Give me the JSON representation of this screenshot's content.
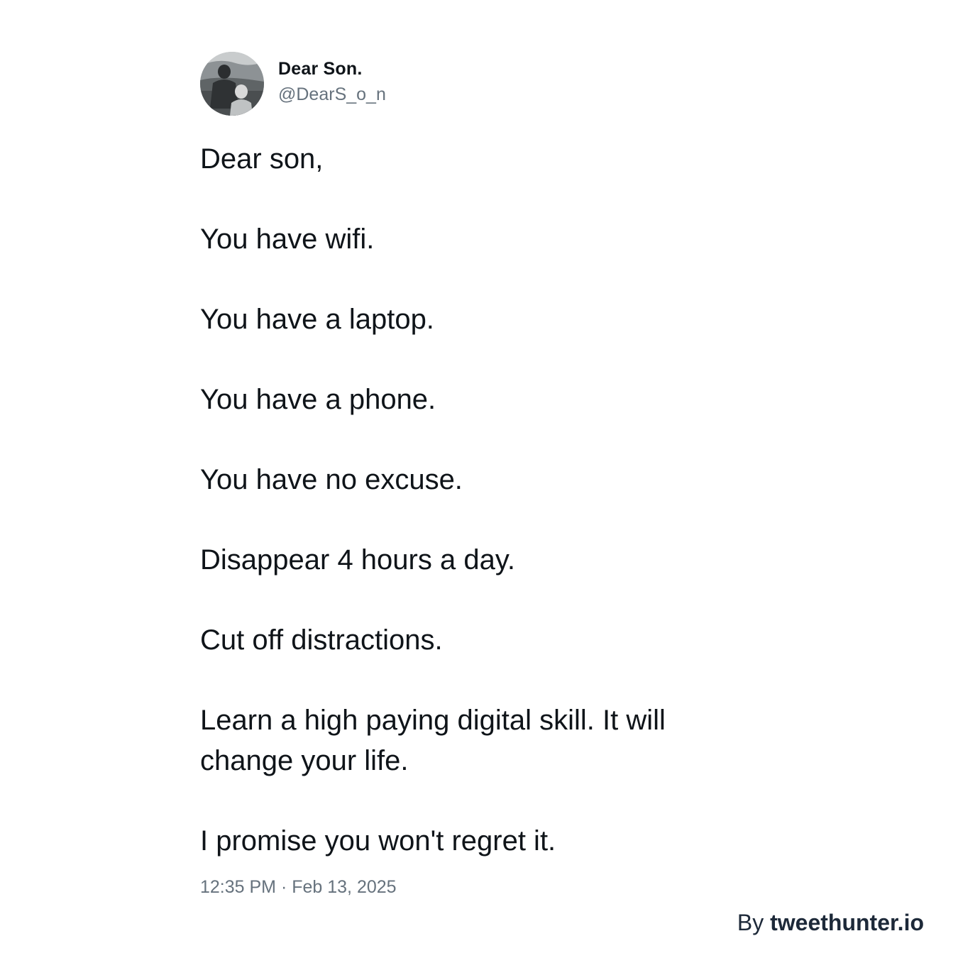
{
  "author": {
    "display_name": "Dear Son.",
    "handle": "@DearS_o_n",
    "avatar_icon": "profile-photo-icon"
  },
  "tweet": {
    "paragraphs": [
      "Dear son,",
      "You have wifi.",
      "You have a laptop.",
      "You have a phone.",
      "You have no excuse.",
      "Disappear 4 hours a day.",
      "Cut off distractions.",
      "Learn a high paying digital skill. It will change your life.",
      "I promise you won't regret it."
    ],
    "timestamp": "12:35 PM · Feb 13, 2025"
  },
  "credit": {
    "prefix": "By",
    "brand": "tweethunter.io"
  },
  "colors": {
    "text": "#0f1419",
    "secondary": "#66727d",
    "credit": "#1d2939",
    "background": "#ffffff"
  }
}
